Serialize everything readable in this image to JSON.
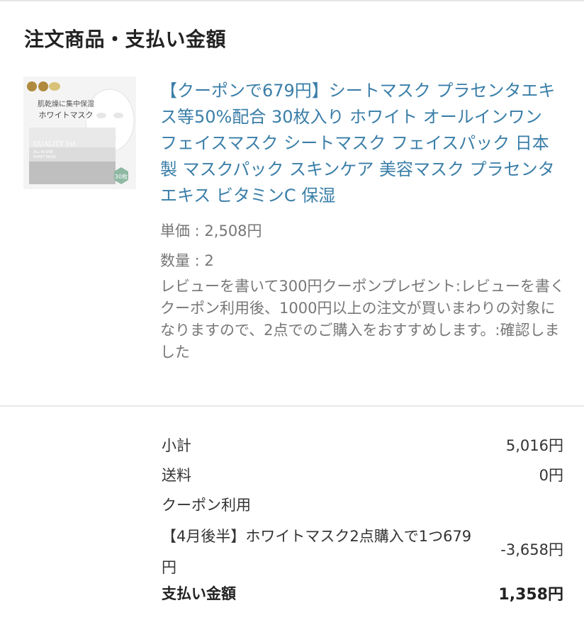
{
  "section": {
    "title": "注文商品・支払い金額"
  },
  "product": {
    "image_icon": "sheet-mask-package-image",
    "image_text": {
      "tagline": "肌乾燥に集中保湿",
      "name": "ホワイトマスク",
      "brand": "QUALITY 1st",
      "sub1": "ALL IN ONE",
      "sub2": "SHEET MASK",
      "count": "30枚"
    },
    "title": "【クーポンで679円】シートマスク プラセンタエキス等50%配合 30枚入り ホワイト オールインワン フェイスマスク シートマスク フェイスパック 日本製 マスクパック スキンケア 美容マスク プラセンタエキス ビタミンC 保湿",
    "unit_price": "単価 : 2,508円",
    "quantity": "数量 : 2",
    "note": "レビューを書いて300円クーポンプレゼント:レビューを書く\nクーポン利用後、1000円以上の注文が買いまわりの対象になりますので、2点でのご購入をおすすめします。:確認しました"
  },
  "summary": {
    "subtotal_label": "小計",
    "subtotal_value": "5,016円",
    "shipping_label": "送料",
    "shipping_value": "0円",
    "coupon_label": "クーポン利用",
    "coupon_name": "【4月後半】ホワイトマスク2点購入で1つ679円",
    "coupon_value": "-3,658円",
    "total_label": "支払い金額",
    "total_value": "1,358円"
  },
  "colors": {
    "link": "#3a7ea8",
    "text": "#333333",
    "muted": "#777777",
    "divider": "#e8e8e8"
  }
}
